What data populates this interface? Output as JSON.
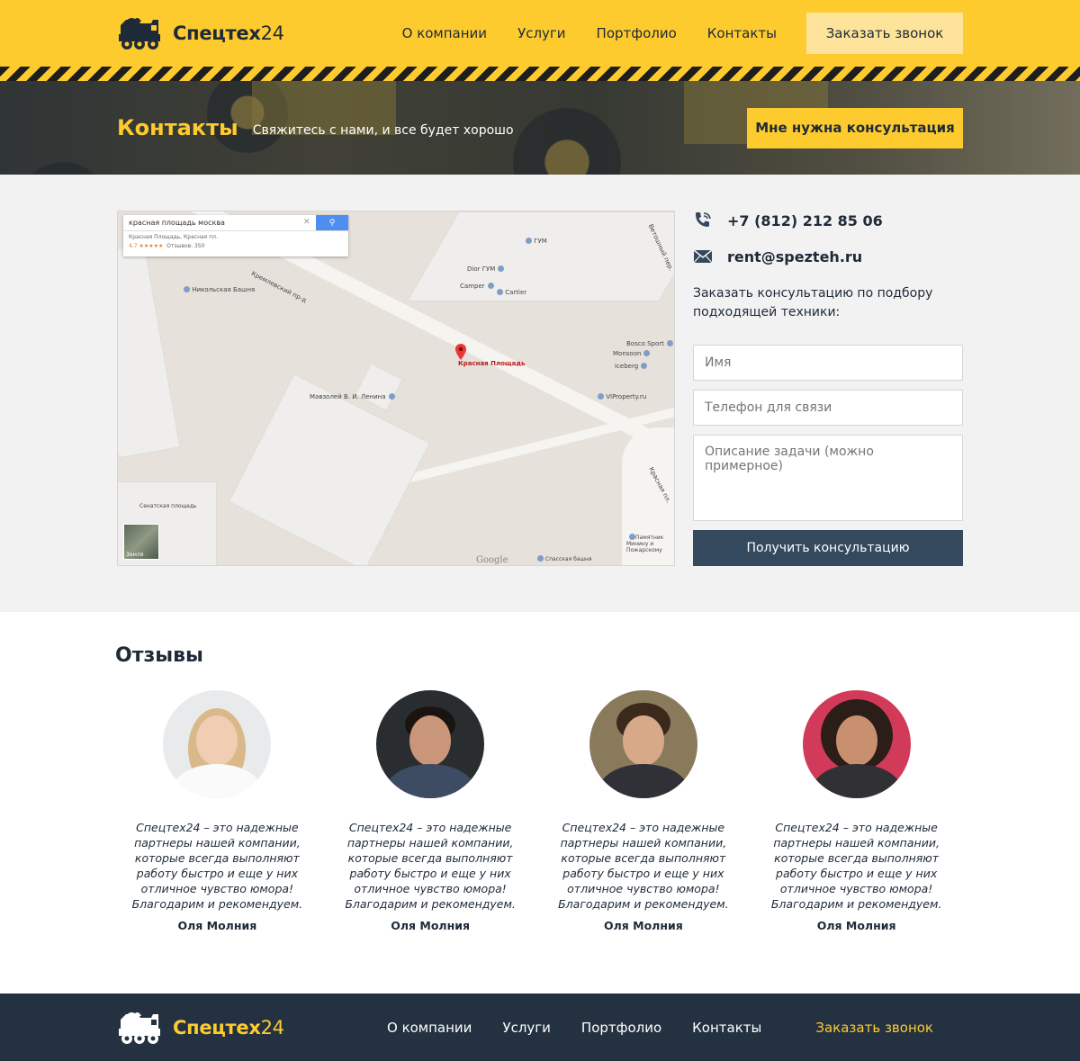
{
  "colors": {
    "brand_yellow": "#fecb2f",
    "dark_navy": "#233140",
    "button_navy": "#34495e",
    "light_gray": "#f2f2f2"
  },
  "header": {
    "logo_icon": "truck-icon",
    "logo_name": "Спецтех",
    "logo_num": "24",
    "nav": [
      "О компании",
      "Услуги",
      "Портфолио",
      "Контакты"
    ],
    "call_button": "Заказать звонок"
  },
  "hero": {
    "title": "Контакты",
    "subtitle": "Свяжитесь с нами, и все будет хорошо",
    "consult_button": "Мне нужна консультация"
  },
  "map": {
    "search_query": "красная площадь москва",
    "search_icon": "search-icon",
    "result_name": "Красная Площадь",
    "result_address": "Красная пл.",
    "rating": "4,7 ★★★★★",
    "reviews_count": "Отзывов: 350",
    "labels": {
      "gum": "ГУМ",
      "dior": "Dior ГУМ",
      "camper": "Camper",
      "cartier": "Cartier",
      "bosco": "Bosco Sport",
      "monsoon": "Monsoon",
      "iceberg": "Iceberg",
      "viproperty": "VIProperty.ru",
      "nikolskaya": "Никольская Башня",
      "kremlin_pr": "Кремлевский пр-д",
      "vetoshny": "Ветошный пер.",
      "red_square": "Красная Площадь",
      "mausoleum": "Мавзолей В. И. Ленина",
      "senate": "Сенатская площадь",
      "monument": "Памятник Минину и Пожарскому",
      "spasskaya": "Спасская башня",
      "krasnaya_pl": "Красная пл.",
      "earth": "Земля",
      "google": "Google"
    }
  },
  "contact": {
    "phone_icon": "phone-icon",
    "phone": "+7 (812) 212 85 06",
    "mail_icon": "mail-icon",
    "email": "rent@spezteh.ru",
    "consult_text": "Заказать консультацию по подбору подходящей техники:",
    "name_placeholder": "Имя",
    "phone_placeholder": "Телефон для связи",
    "task_placeholder": "Описание задачи (можно примерное)",
    "submit": "Получить консультацию"
  },
  "reviews": {
    "title": "Отзывы",
    "items": [
      {
        "text": "Спецтех24 – это надежные партнеры нашей компании, которые всегда выполняют работу быстро и еще у них отличное чувство юмора! Благодарим и рекомендуем.",
        "author": "Оля Молния"
      },
      {
        "text": "Спецтех24 – это надежные партнеры нашей компании, которые всегда выполняют работу быстро и еще у них отличное чувство юмора! Благодарим и рекомендуем.",
        "author": "Оля Молния"
      },
      {
        "text": "Спецтех24 – это надежные партнеры нашей компании, которые всегда выполняют работу быстро и еще у них отличное чувство юмора! Благодарим и рекомендуем.",
        "author": "Оля Молния"
      },
      {
        "text": "Спецтех24 – это надежные партнеры нашей компании, которые всегда выполняют работу быстро и еще у них отличное чувство юмора! Благодарим и рекомендуем.",
        "author": "Оля Молния"
      }
    ]
  },
  "footer": {
    "logo_name": "Спецтех",
    "logo_num": "24",
    "nav": [
      "О компании",
      "Услуги",
      "Портфолио",
      "Контакты"
    ],
    "call_link": "Заказать звонок"
  }
}
